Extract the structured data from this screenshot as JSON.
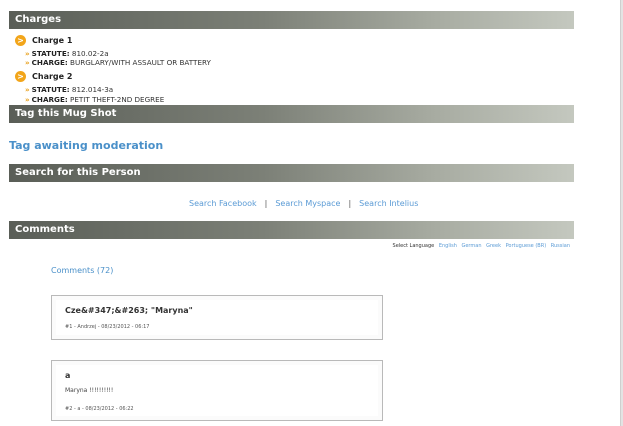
{
  "sections": {
    "charges": "Charges",
    "tag": "Tag this Mug Shot",
    "search": "Search for this Person",
    "comments": "Comments"
  },
  "charges": [
    {
      "bullet": ">",
      "heading": "Charge 1",
      "statute_label": "STATUTE:",
      "statute": "810.02-2a",
      "charge_label": "CHARGE:",
      "charge": "BURGLARY/WITH ASSAULT OR BATTERY"
    },
    {
      "bullet": ">",
      "heading": "Charge 2",
      "statute_label": "STATUTE:",
      "statute": "812.014-3a",
      "charge_label": "CHARGE:",
      "charge": "PETIT THEFT-2ND DEGREE"
    }
  ],
  "tag_status": "Tag awaiting moderation",
  "search_links": [
    "Search Facebook",
    "Search Myspace",
    "Search Intelius"
  ],
  "search_separator": "|",
  "language": {
    "label": "Select Language",
    "options": [
      "English",
      "German",
      "Greek",
      "Portuguese (BR)",
      "Russian"
    ]
  },
  "comments_count": "Comments (72)",
  "comments": [
    {
      "title": "Cze&#347;&#263; \"Maryna\"",
      "body": "",
      "meta": "#1 - Andrzej - 08/23/2012 - 06:17"
    },
    {
      "title": "a",
      "body": "Maryna !!!!!!!!!!",
      "meta": "#2 - a - 08/23/2012 - 06:22"
    }
  ],
  "colors": {
    "link": "#5b9bd5",
    "bullet": "#f2a51a",
    "bar_dark": "#5a5e57",
    "bar_light": "#c4c8bf"
  }
}
